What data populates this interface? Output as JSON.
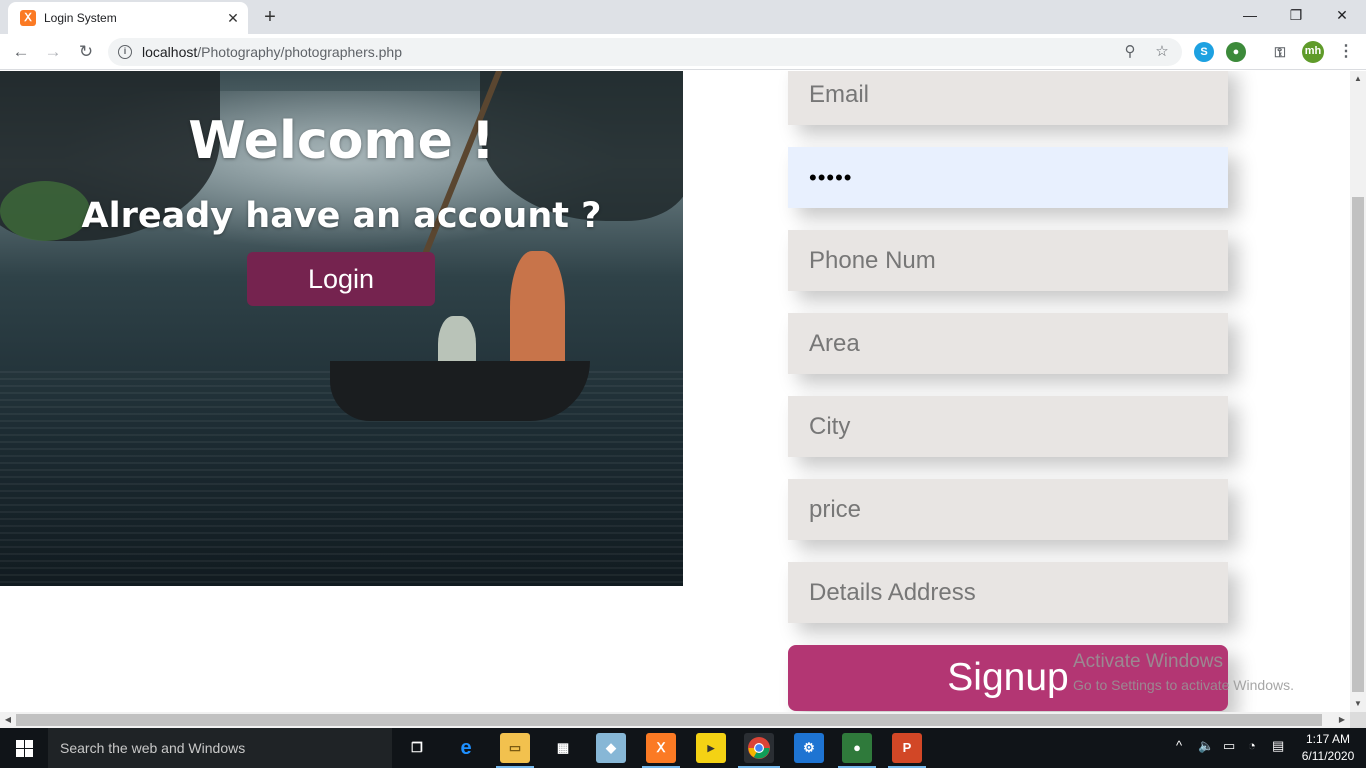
{
  "browser": {
    "tab_title": "Login System",
    "tab_favicon": "xampp-icon",
    "url_host": "localhost",
    "url_path": "/Photography/photographers.php",
    "profile_initials": "mh"
  },
  "hero": {
    "welcome": "Welcome !",
    "subtitle": "Already have an account ?",
    "login_label": "Login"
  },
  "form": {
    "email_placeholder": "Email",
    "password_value": "•••••",
    "phone_placeholder": "Phone Num",
    "area_placeholder": "Area",
    "city_placeholder": "City",
    "price_placeholder": "price",
    "address_placeholder": "Details Address",
    "signup_label": "Signup"
  },
  "watermark": {
    "line1": "Activate Windows",
    "line2": "Go to Settings to activate Windows."
  },
  "taskbar": {
    "search_placeholder": "Search the web and Windows",
    "time": "1:17 AM",
    "date": "6/11/2020"
  },
  "colors": {
    "login_button": "#75234f",
    "signup_button": "#b33673",
    "field_bg": "#e8e5e3",
    "active_field_bg": "#e8f0fe"
  }
}
